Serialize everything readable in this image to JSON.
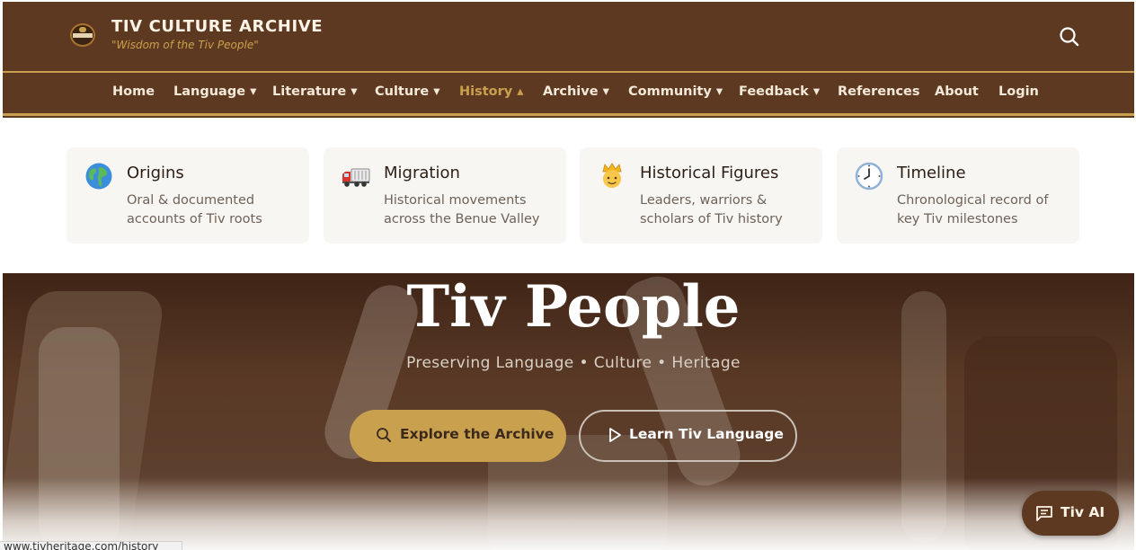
{
  "header": {
    "title": "TIV CULTURE ARCHIVE",
    "tagline": "\"Wisdom of the Tiv People\"",
    "logo_icon": "tiv-heritage-logo",
    "search_icon": "search-icon"
  },
  "nav": {
    "items": [
      {
        "label": "Home"
      },
      {
        "label": "Language ▾"
      },
      {
        "label": "Literature ▾"
      },
      {
        "label": "Culture ▾"
      },
      {
        "label": "History ▴",
        "active": true
      },
      {
        "label": "Archive ▾"
      },
      {
        "label": "Community ▾"
      },
      {
        "label": "Feedback ▾"
      },
      {
        "label": "References"
      },
      {
        "label": "About"
      },
      {
        "label": "Login"
      }
    ]
  },
  "dropdown": {
    "cards": [
      {
        "icon": "globe-icon",
        "title": "Origins",
        "desc": "Oral & documented accounts of Tiv roots"
      },
      {
        "icon": "truck-icon",
        "title": "Migration",
        "desc": "Historical movements across the Benue Valley"
      },
      {
        "icon": "crowned-person-icon",
        "title": "Historical Figures",
        "desc": "Leaders, warriors & scholars of Tiv history"
      },
      {
        "icon": "clock-icon",
        "title": "Timeline",
        "desc": "Chronological record of key Tiv milestones"
      }
    ]
  },
  "hero": {
    "title": "Tiv People",
    "subtitle": "Preserving Language • Culture • Heritage",
    "primary_button": "Explore the Archive",
    "secondary_button": "Learn Tiv Language"
  },
  "ai_chat": {
    "label": "Tiv AI",
    "icon": "chat-icon"
  },
  "status_bar": {
    "url": "www.tivheritage.com/history"
  },
  "colors": {
    "brand_brown": "#5e3922",
    "accent_gold": "#c9a04e",
    "card_bg": "#f8f6f3"
  }
}
